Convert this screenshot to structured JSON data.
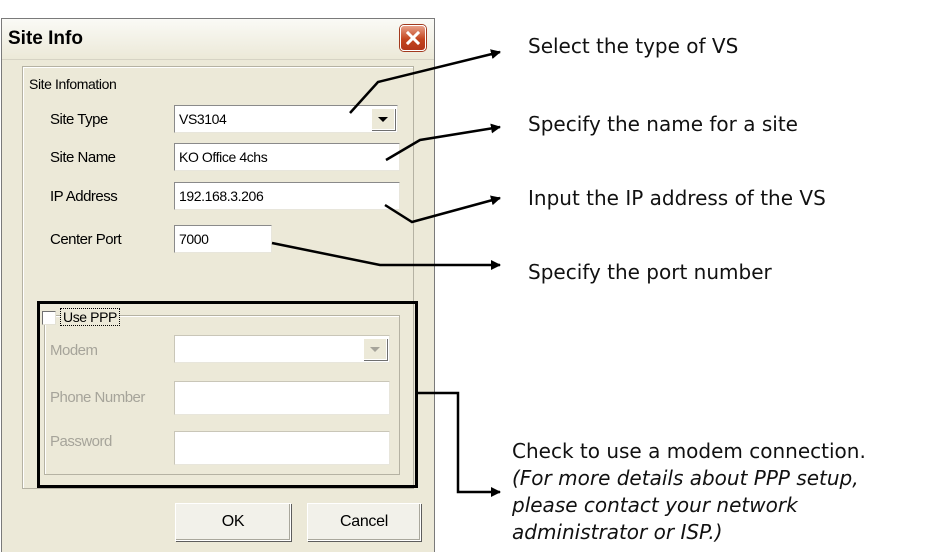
{
  "dialog": {
    "title": "Site Info",
    "site_group": {
      "legend": "Site Infomation",
      "site_type": {
        "label": "Site Type",
        "value": "VS3104"
      },
      "site_name": {
        "label": "Site Name",
        "value": "KO Office 4chs"
      },
      "ip_address": {
        "label": "IP Address",
        "value": "192.168.3.206"
      },
      "center_port": {
        "label": "Center Port",
        "value": "7000"
      }
    },
    "ppp_group": {
      "checkbox_label": "Use PPP",
      "checked": false,
      "modem": {
        "label": "Modem",
        "value": ""
      },
      "phone_number": {
        "label": "Phone Number",
        "value": ""
      },
      "password": {
        "label": "Password",
        "value": ""
      }
    },
    "buttons": {
      "ok": "OK",
      "cancel": "Cancel"
    }
  },
  "annotations": {
    "site_type": "Select the type of VS",
    "site_name": "Specify the name for a site",
    "ip_address": "Input the IP address of the VS",
    "center_port": "Specify the port number",
    "ppp_line1": "Check to use a modem connection.",
    "ppp_line2": "(For more details about PPP setup,",
    "ppp_line3": "please contact your network",
    "ppp_line4": "administrator or ISP.)"
  },
  "colors": {
    "dialog_background": "#ece9d8",
    "close_button": "#c3451f",
    "disabled_text": "#a6a49a"
  },
  "icons": {
    "close": "close-icon",
    "dropdown": "chevron-down-icon",
    "arrow": "arrow-right-icon"
  }
}
